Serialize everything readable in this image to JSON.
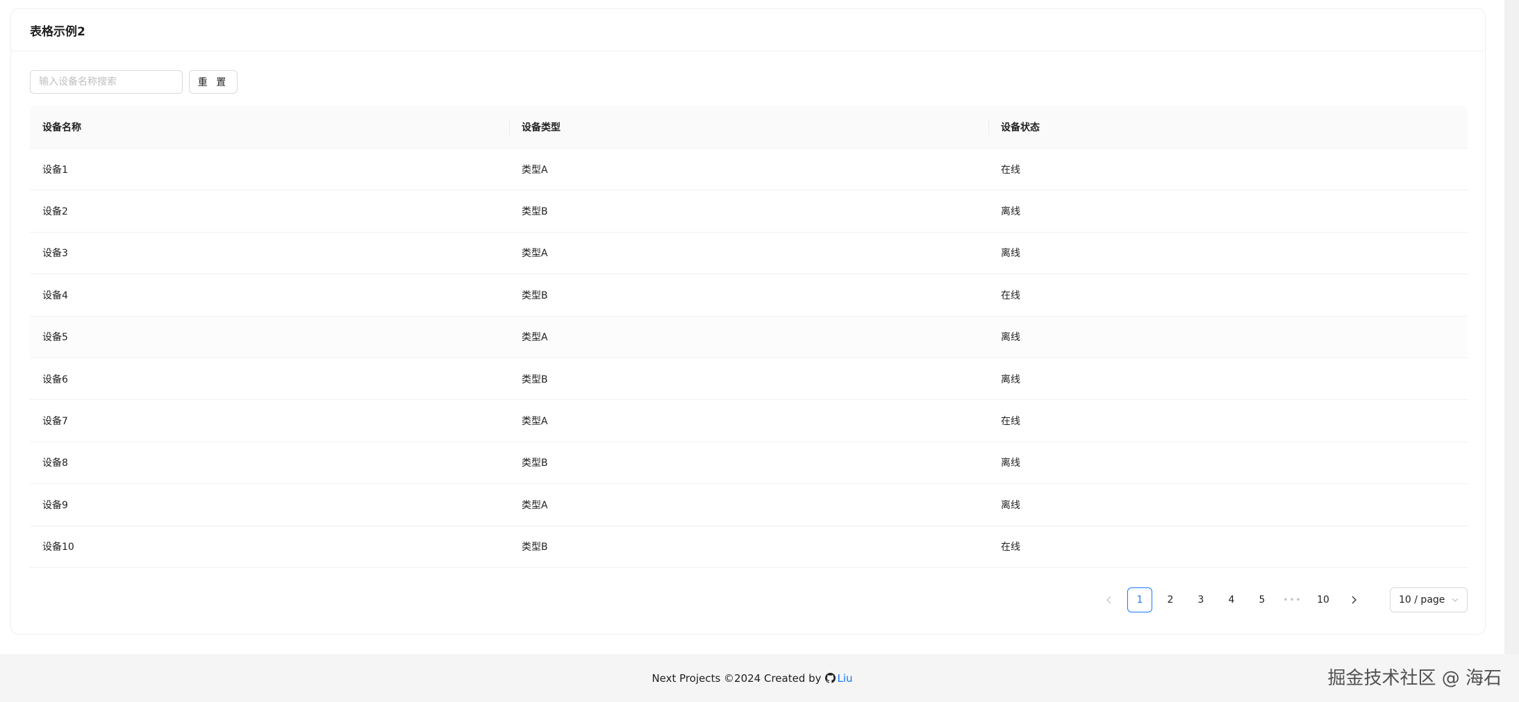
{
  "card": {
    "title": "表格示例2"
  },
  "toolbar": {
    "search_placeholder": "输入设备名称搜索",
    "search_value": "",
    "reset_label": "重 置"
  },
  "table": {
    "columns": [
      "设备名称",
      "设备类型",
      "设备状态"
    ],
    "rows": [
      [
        "设备1",
        "类型A",
        "在线"
      ],
      [
        "设备2",
        "类型B",
        "离线"
      ],
      [
        "设备3",
        "类型A",
        "离线"
      ],
      [
        "设备4",
        "类型B",
        "在线"
      ],
      [
        "设备5",
        "类型A",
        "离线"
      ],
      [
        "设备6",
        "类型B",
        "离线"
      ],
      [
        "设备7",
        "类型A",
        "在线"
      ],
      [
        "设备8",
        "类型B",
        "离线"
      ],
      [
        "设备9",
        "类型A",
        "离线"
      ],
      [
        "设备10",
        "类型B",
        "在线"
      ]
    ]
  },
  "pagination": {
    "prev_icon": "chevron-left-icon",
    "next_icon": "chevron-right-icon",
    "pages": [
      "1",
      "2",
      "3",
      "4",
      "5"
    ],
    "ellipsis": "•••",
    "last_page": "10",
    "current": "1",
    "page_size": "10 / page"
  },
  "footer": {
    "text": "Next Projects ©2024 Created by",
    "link_label": "Liu",
    "icon": "github-icon"
  },
  "watermark": "掘金技术社区 @ 海石",
  "colors": {
    "primary": "#1677ff",
    "border": "#d9d9d9",
    "header_bg": "#fafafa",
    "page_bg": "#f5f5f5"
  }
}
